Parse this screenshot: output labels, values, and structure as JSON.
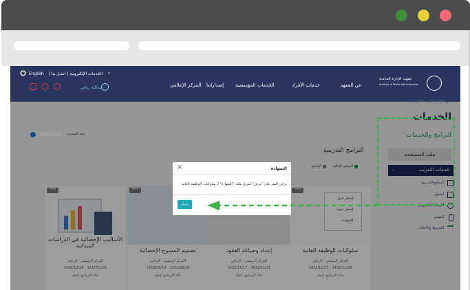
{
  "window": {
    "dots": [
      "#3e8f3a",
      "#e8d23a",
      "#ee6a79"
    ]
  },
  "site": {
    "lang_label": "English",
    "top_links": "الخدمات الإلكترونية | اتصل بنا |",
    "user_name": "عبدالله رياض",
    "logo_ar": "معهـد الإدارة العـامـة",
    "logo_en": "Institute of Public Administration",
    "nav": [
      "عن المعهد",
      "خدمات الأفراد",
      "الخدمات المؤسسية",
      "إصداراتنا",
      "المركز الإعلامي"
    ],
    "breadcrumb": "معهد الإدارة العامة > الخدمات"
  },
  "sidebar": {
    "title": "الخدمات",
    "subtitle": "البرامج والخدمات",
    "profile": "ملف المستخدم",
    "training_header": "خدمات التدريب",
    "items": [
      {
        "label": "البرامج التدريبية",
        "icon": "grid-icon"
      },
      {
        "label": "الجدول",
        "icon": "calendar-icon"
      },
      {
        "label": "الإرشاد الإلكتروني",
        "icon": "people-icon"
      },
      {
        "label": "الفواتير",
        "icon": "invoice-icon"
      },
      {
        "label": "الشروط والأحكام",
        "icon": "scale-icon"
      }
    ]
  },
  "main": {
    "trainee_label": "رقم المتدرب",
    "section_title": "البرامج التدريبية",
    "filters": [
      "البرامج الحالية",
      "البرامج"
    ],
    "dropdown": [
      "إشعار قبول",
      "إشعار نتيجة",
      "الشهادة"
    ],
    "cards": [
      {
        "title": "سلوكيات الوظيفة العامة",
        "center": "المركز الرئيسي - الرياض",
        "dates": "1432/11/28 - 1432/11/27",
        "status": "حالة البرنامج: إنجاز"
      },
      {
        "title": "إعداد وصياغة العقود",
        "center": "المركز الرئيسي - الرياض",
        "dates": "1432/11/21 - 1432/11/17",
        "status": "حالة البرنامج: إنجاز"
      },
      {
        "title": "تصميم المسوح الإحصائية",
        "center": "المركز الرئيسي - الرياض",
        "dates": "1433/06/16 - 1433/06/14",
        "status": "حالة البرنامج: إنجاز"
      },
      {
        "title": "الأساليب الإحصائية في الدراسات الميدانية",
        "center": "المركز الرئيسي - الرياض",
        "dates": "1437/01/02 - 1436/12/28",
        "status": "حالة البرنامج: إنجاز"
      }
    ]
  },
  "modal": {
    "title": "الشهادة",
    "body": "يرجى النقر على \"تنزيل\" لتنزيل ملف \"الشهادة\" لـ سلوكيات الوظيفة العامة",
    "download": "تنزيل",
    "close": "×"
  }
}
